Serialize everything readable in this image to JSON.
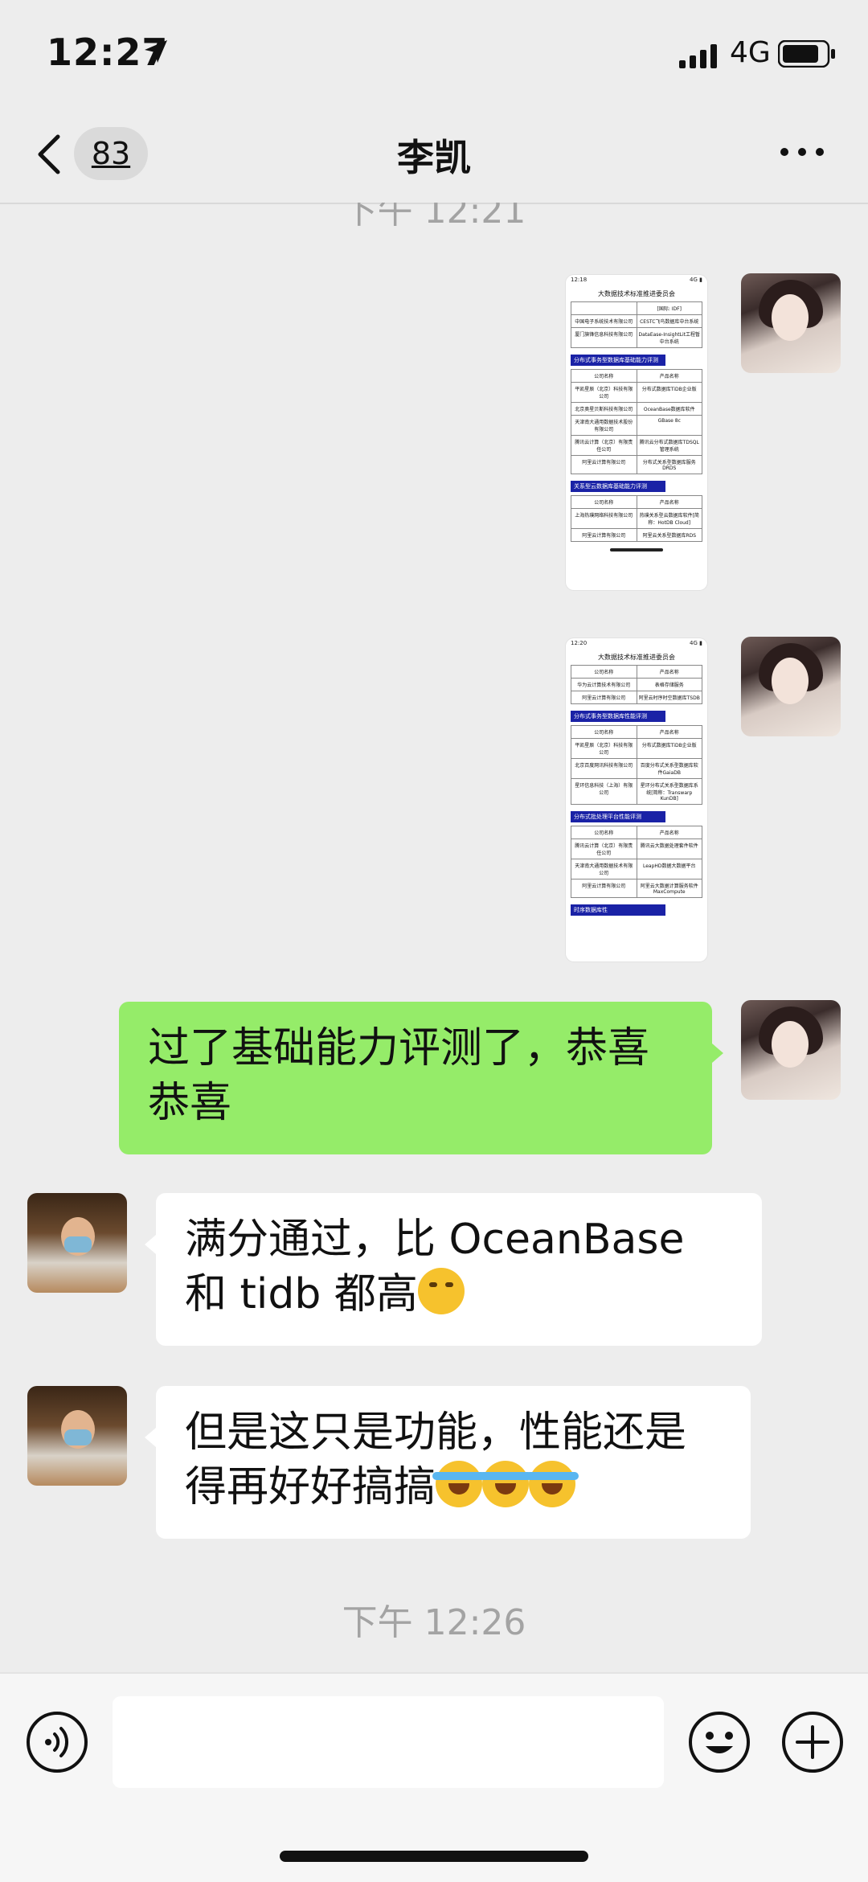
{
  "status": {
    "time": "12:27",
    "network": "4G"
  },
  "nav": {
    "unread_count": "83",
    "title": "李凯"
  },
  "chat": {
    "timestamp_top": "下午 12:21",
    "image1": {
      "time": "12:18",
      "header": "大数据技术标准推进委员会",
      "rows_top": [
        [
          "",
          "[国际: IDF]"
        ],
        [
          "中国电子系统技术有限公司",
          "CESTC飞鸟数据库中台系统"
        ],
        [
          "厦门旗锋信息科技有限公司",
          "DataEase-InsightLit工程暂中台系统"
        ]
      ],
      "section1": "分布式事务型数据库基础能力评测",
      "section1_header": [
        "公司名称",
        "产品名称"
      ],
      "section1_rows": [
        [
          "平凯星辰（北京）科技有限公司",
          "分布式数据库TiDB企业版"
        ],
        [
          "北京奥星贝斯科技有限公司",
          "OceanBase数据库软件"
        ],
        [
          "天津南大通用数据技术股份有限公司",
          "GBase 8c"
        ],
        [
          "腾讯云计算（北京）有限责任公司",
          "腾讯云分布式数据库TDSQL管理系统"
        ],
        [
          "阿里云计算有限公司",
          "分布式关系型数据库服务DRDS"
        ]
      ],
      "section2": "关系型云数据库基础能力评测",
      "section2_header": [
        "公司名称",
        "产品名称"
      ],
      "section2_rows": [
        [
          "上海热璞网络科技有限公司",
          "热璞关系型云数据库软件[简称：HotDB Cloud]"
        ],
        [
          "阿里云计算有限公司",
          "阿里云关系型数据库RDS"
        ]
      ]
    },
    "image2": {
      "time": "12:20",
      "header": "大数据技术标准推进委员会",
      "rows_top": [
        [
          "公司名称",
          "产品名称"
        ],
        [
          "华为云计算技术有限公司",
          "表格存储服务"
        ],
        [
          "阿里云计算有限公司",
          "阿里云时序时空数据库TSDB"
        ]
      ],
      "section1": "分布式事务型数据库性能评测",
      "section1_header": [
        "公司名称",
        "产品名称"
      ],
      "section1_rows": [
        [
          "平凯星辰（北京）科技有限公司",
          "分布式数据库TiDB企业版"
        ],
        [
          "北京百度网讯科技有限公司",
          "百度分布式关系型数据库软件GaiaDB"
        ],
        [
          "星环信息科技（上海）有限公司",
          "星环分布式关系型数据库系统[简称：Transwarp KunDB]"
        ]
      ],
      "section2": "分布式批处理平台性能评测",
      "section2_header": [
        "公司名称",
        "产品名称"
      ],
      "section2_rows": [
        [
          "腾讯云计算（北京）有限责任公司",
          "腾讯云大数据处理套件软件"
        ],
        [
          "天津南大通用数据技术有限公司",
          "LeapHD数据大数据平台"
        ],
        [
          "阿里云计算有限公司",
          "阿里云大数据计算服务软件MaxCompute"
        ]
      ],
      "section3": "时序数据库性"
    },
    "msg_me": "过了基础能力评测了，恭喜恭喜",
    "msg_them1": "满分通过，比 OceanBase 和 tidb 都高",
    "msg_them2": "但是这只是功能，性能还是得再好好搞搞",
    "timestamp_bottom": "下午 12:26"
  },
  "icons": {
    "emoji1": "smirk-emoji",
    "emoji2": "loudly-crying-emoji"
  }
}
